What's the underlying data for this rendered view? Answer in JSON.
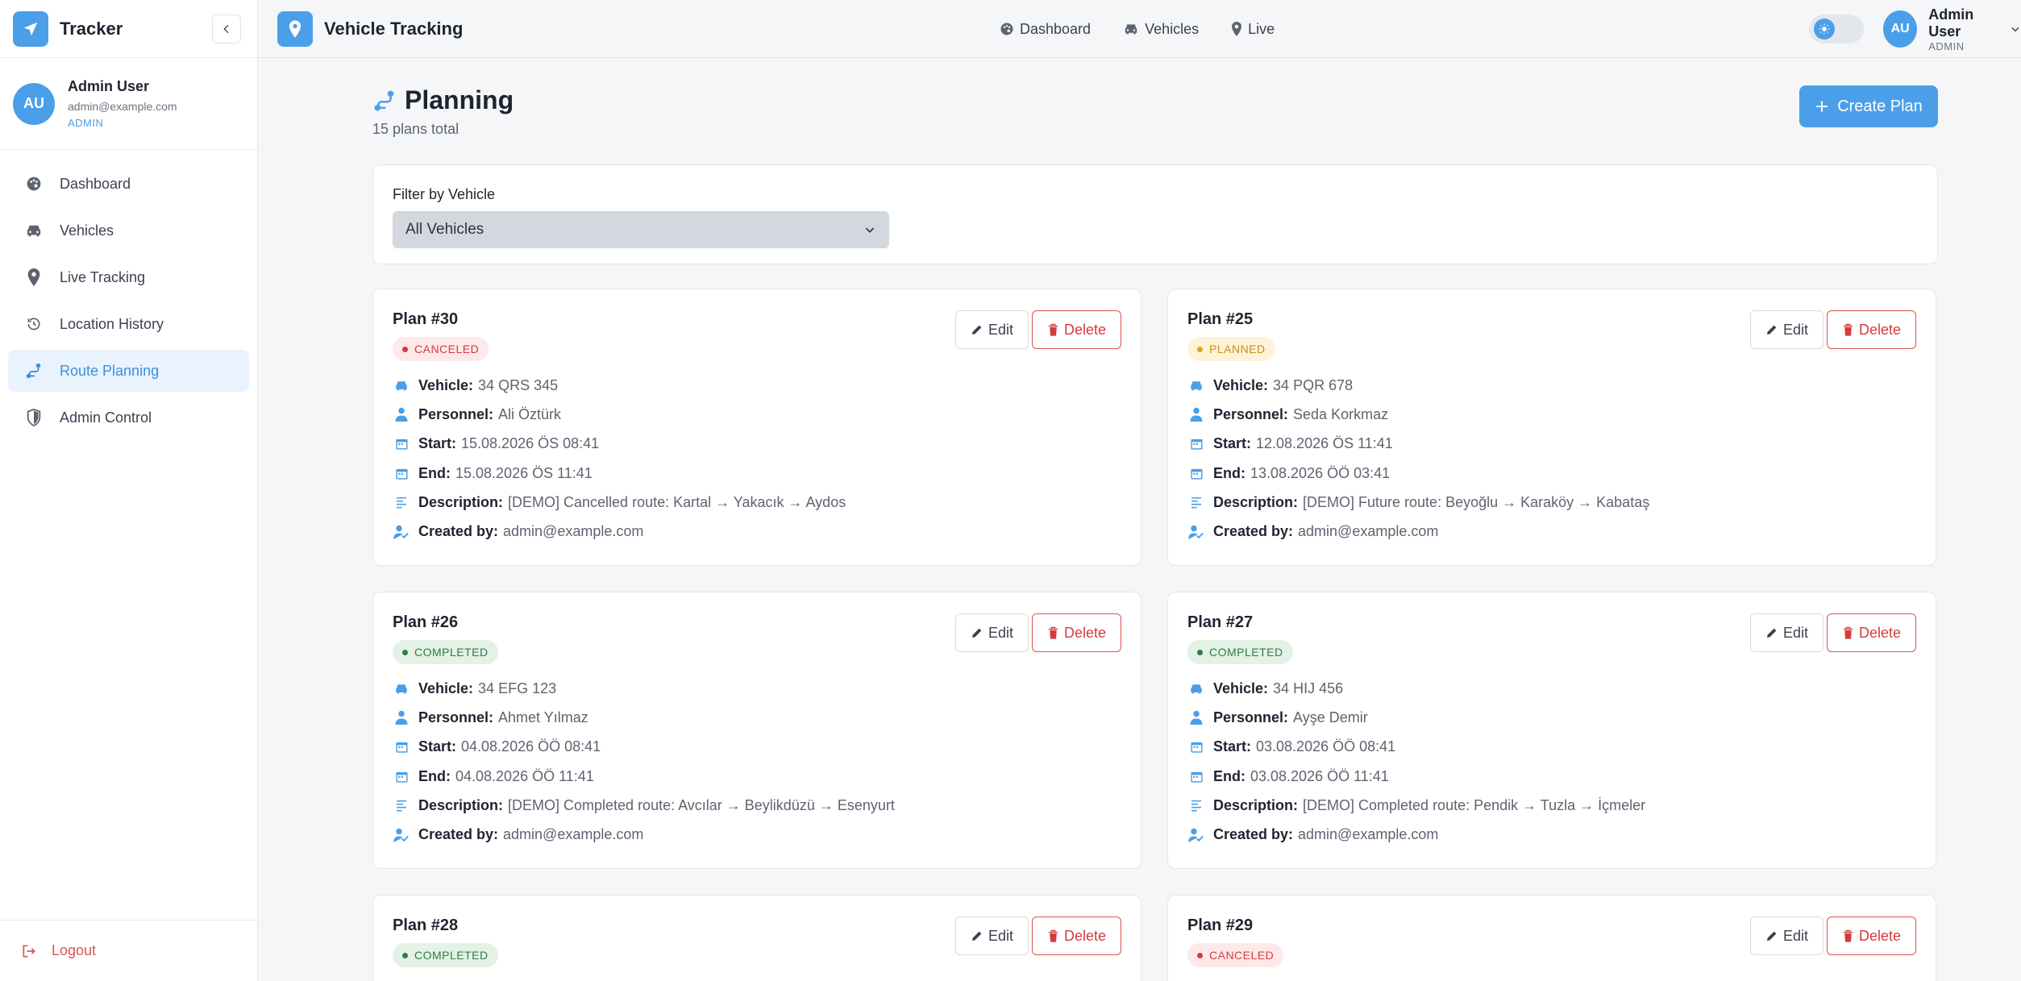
{
  "sidebar": {
    "brand": "Tracker",
    "user": {
      "initials": "AU",
      "name": "Admin User",
      "email": "admin@example.com",
      "role": "ADMIN"
    },
    "items": [
      {
        "label": "Dashboard",
        "icon": "palette-icon"
      },
      {
        "label": "Vehicles",
        "icon": "car-icon"
      },
      {
        "label": "Live Tracking",
        "icon": "map-pin-icon"
      },
      {
        "label": "Location History",
        "icon": "history-icon"
      },
      {
        "label": "Route Planning",
        "icon": "route-icon"
      },
      {
        "label": "Admin Control",
        "icon": "shield-icon"
      }
    ],
    "logout": "Logout"
  },
  "topbar": {
    "title": "Vehicle Tracking",
    "links": [
      "Dashboard",
      "Vehicles",
      "Live"
    ],
    "user": {
      "initials": "AU",
      "name": "Admin User",
      "role": "ADMIN"
    }
  },
  "page": {
    "title": "Planning",
    "subtitle": "15 plans total",
    "create_label": "Create Plan"
  },
  "filter": {
    "label": "Filter by Vehicle",
    "value": "All Vehicles"
  },
  "labels": {
    "vehicle": "Vehicle:",
    "personnel": "Personnel:",
    "start": "Start:",
    "end": "End:",
    "description": "Description:",
    "created_by": "Created by:",
    "edit": "Edit",
    "delete": "Delete"
  },
  "plans": [
    {
      "title": "Plan #30",
      "status": "CANCELED",
      "vehicle": "34 QRS 345",
      "personnel": "Ali Öztürk",
      "start": "15.08.2026 ÖS 08:41",
      "end": "15.08.2026 ÖS 11:41",
      "description": "[DEMO] Cancelled route: Kartal → Yakacık → Aydos",
      "created_by": "admin@example.com"
    },
    {
      "title": "Plan #25",
      "status": "PLANNED",
      "vehicle": "34 PQR 678",
      "personnel": "Seda Korkmaz",
      "start": "12.08.2026 ÖS 11:41",
      "end": "13.08.2026 ÖÖ 03:41",
      "description": "[DEMO] Future route: Beyoğlu → Karaköy → Kabataş",
      "created_by": "admin@example.com"
    },
    {
      "title": "Plan #26",
      "status": "COMPLETED",
      "vehicle": "34 EFG 123",
      "personnel": "Ahmet Yılmaz",
      "start": "04.08.2026 ÖÖ 08:41",
      "end": "04.08.2026 ÖÖ 11:41",
      "description": "[DEMO] Completed route: Avcılar → Beylikdüzü → Esenyurt",
      "created_by": "admin@example.com"
    },
    {
      "title": "Plan #27",
      "status": "COMPLETED",
      "vehicle": "34 HIJ 456",
      "personnel": "Ayşe Demir",
      "start": "03.08.2026 ÖÖ 08:41",
      "end": "03.08.2026 ÖÖ 11:41",
      "description": "[DEMO] Completed route: Pendik → Tuzla → İçmeler",
      "created_by": "admin@example.com"
    },
    {
      "title": "Plan #28",
      "status": "COMPLETED"
    },
    {
      "title": "Plan #29",
      "status": "CANCELED"
    }
  ],
  "colors": {
    "accent": "#4a9fe8",
    "danger": "#d43c3c",
    "planned": "#c89313",
    "completed": "#2e7d45"
  }
}
